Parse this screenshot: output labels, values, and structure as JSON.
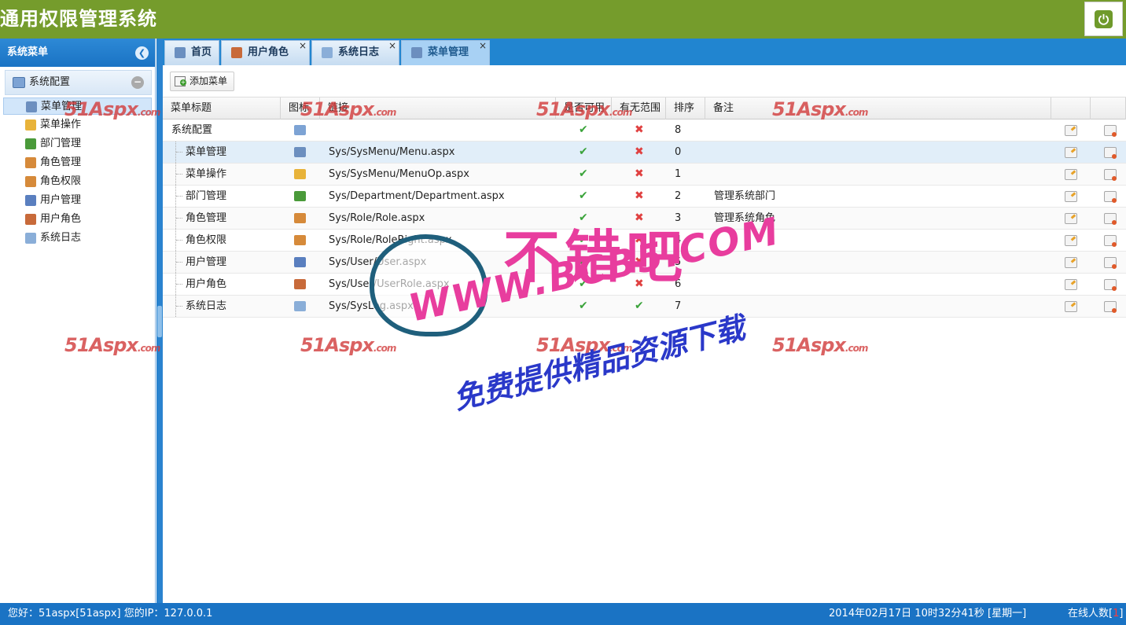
{
  "app": {
    "title": "通用权限管理系统"
  },
  "sidebar": {
    "title": "系统菜单",
    "group_label": "系统配置",
    "items": [
      {
        "label": "菜单管理",
        "icon": "grid-icon"
      },
      {
        "label": "菜单操作",
        "icon": "form-edit-icon"
      },
      {
        "label": "部门管理",
        "icon": "org-chart-icon"
      },
      {
        "label": "角色管理",
        "icon": "users-icon"
      },
      {
        "label": "角色权限",
        "icon": "user-key-icon"
      },
      {
        "label": "用户管理",
        "icon": "user-icon"
      },
      {
        "label": "用户角色",
        "icon": "user-role-icon"
      },
      {
        "label": "系统日志",
        "icon": "document-icon"
      }
    ]
  },
  "tabs": [
    {
      "label": "首页",
      "icon": "home-icon",
      "closable": false
    },
    {
      "label": "用户角色",
      "icon": "user-role-icon",
      "closable": true
    },
    {
      "label": "系统日志",
      "icon": "document-icon",
      "closable": true
    },
    {
      "label": "菜单管理",
      "icon": "grid-icon",
      "closable": true,
      "active": true
    }
  ],
  "toolbar": {
    "add_label": "添加菜单"
  },
  "grid": {
    "columns": [
      "菜单标题",
      "图标",
      "链接",
      "是否可用",
      "有无范围",
      "排序",
      "备注"
    ],
    "rows": [
      {
        "title": "系统配置",
        "link": "",
        "enabled": true,
        "scope": false,
        "order": "8",
        "remark": "",
        "level": 0
      },
      {
        "title": "菜单管理",
        "link": "Sys/SysMenu/Menu.aspx",
        "enabled": true,
        "scope": false,
        "order": "0",
        "remark": "",
        "level": 1
      },
      {
        "title": "菜单操作",
        "link": "Sys/SysMenu/MenuOp.aspx",
        "enabled": true,
        "scope": false,
        "order": "1",
        "remark": "",
        "level": 1
      },
      {
        "title": "部门管理",
        "link": "Sys/Department/Department.aspx",
        "enabled": true,
        "scope": false,
        "order": "2",
        "remark": "管理系统部门",
        "level": 1
      },
      {
        "title": "角色管理",
        "link": "Sys/Role/Role.aspx",
        "enabled": true,
        "scope": false,
        "order": "3",
        "remark": "管理系统角色",
        "level": 1
      },
      {
        "title": "角色权限",
        "link": "Sys/Role/RoleRight.aspx",
        "enabled": true,
        "scope": false,
        "order": "4",
        "remark": "",
        "level": 1
      },
      {
        "title": "用户管理",
        "link": "Sys/User/User.aspx",
        "enabled": true,
        "scope": false,
        "order": "5",
        "remark": "",
        "level": 1
      },
      {
        "title": "用户角色",
        "link": "Sys/User/UserRole.aspx",
        "enabled": true,
        "scope": false,
        "order": "6",
        "remark": "",
        "level": 1
      },
      {
        "title": "系统日志",
        "link": "Sys/SysLog.aspx",
        "enabled": true,
        "scope": true,
        "order": "7",
        "remark": "",
        "level": 1
      }
    ]
  },
  "status": {
    "user": "您好：51aspx[51aspx] 您的IP：127.0.0.1",
    "time": "2014年02月17日 10时32分41秒 [星期一]",
    "online_label": "在线人数[",
    "online_count": "1",
    "online_end": "]"
  },
  "watermark": {
    "brand": "51Aspx",
    "domain": ".com",
    "big": "不错吧",
    "url": "WWW.BCB5.COM",
    "sub": "免费提供精品资源下载"
  },
  "colors": {
    "header": "#759c2c",
    "primary": "#1a73c4",
    "check": "#3aa33a",
    "cross": "#e04040"
  }
}
